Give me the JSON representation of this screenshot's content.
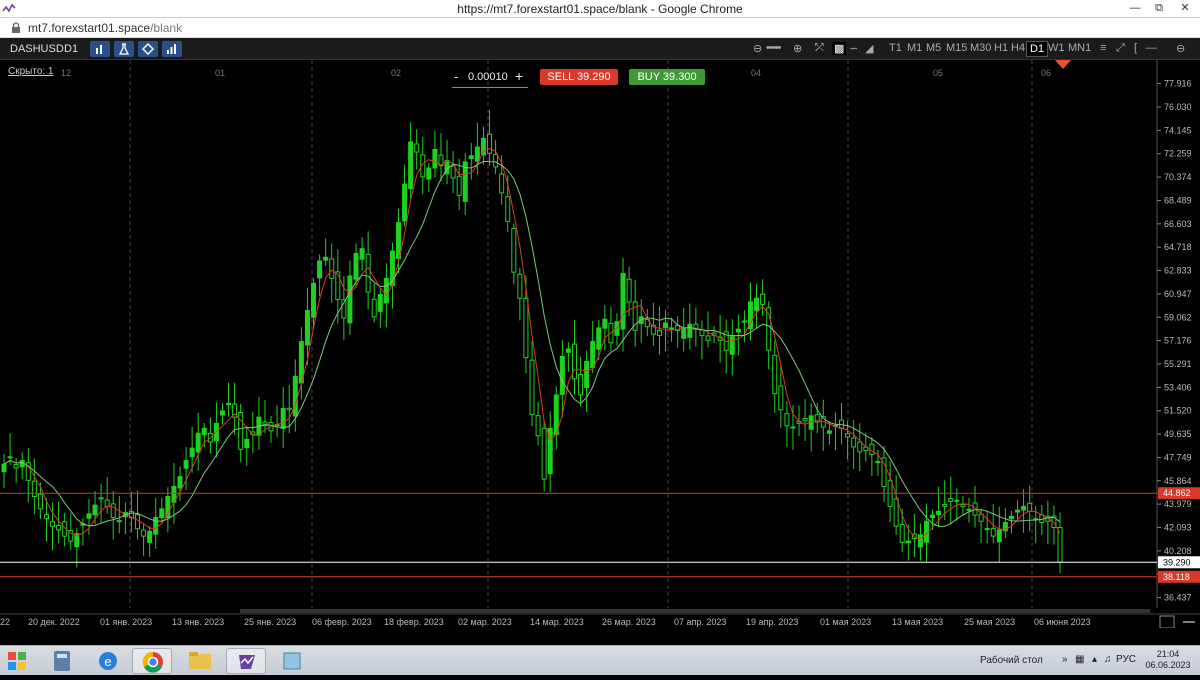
{
  "browser": {
    "window_title": "https://mt7.forexstart01.space/blank - Google Chrome",
    "url_host": "mt7.forexstart01.space",
    "url_path": "/blank"
  },
  "toolbar": {
    "symbol": "DASHUSD",
    "timeframe": "D1",
    "timeframes": [
      "T1",
      "M1",
      "M5",
      "M15",
      "M30",
      "H1",
      "H4",
      "D1",
      "W1",
      "MN1"
    ],
    "active_timeframe": "D1"
  },
  "chart": {
    "hidden_link": "Скрыто: 1",
    "lot": "0.00010",
    "lot_minus": "-",
    "lot_plus": "+",
    "sell_label": "SELL 39.290",
    "buy_label": "BUY 39.300"
  },
  "taskbar": {
    "desktop_label": "Рабочий стол",
    "language": "РУС",
    "time": "21:04",
    "date": "06.06.2023"
  },
  "chart_data": {
    "type": "candlestick",
    "symbol": "DASHUSD",
    "timeframe": "D1",
    "y_ticks": [
      77.916,
      76.03,
      74.145,
      72.259,
      70.374,
      68.489,
      66.603,
      64.718,
      62.833,
      60.947,
      59.062,
      57.176,
      55.291,
      53.406,
      51.52,
      49.635,
      47.749,
      45.864,
      43.979,
      42.093,
      40.208,
      38.323,
      36.437
    ],
    "ylim": [
      35.6,
      79.5
    ],
    "x_tick_labels": [
      "22",
      "20 дек. 2022",
      "01 янв. 2023",
      "13 янв. 2023",
      "25 янв. 2023",
      "06 февр. 2023",
      "18 февр. 2023",
      "02 мар. 2023",
      "14 мар. 2023",
      "26 мар. 2023",
      "07 апр. 2023",
      "19 апр. 2023",
      "01 мая 2023",
      "13 мая 2023",
      "25 мая 2023",
      "06 июня 2023"
    ],
    "top_labels": [
      "12",
      "01",
      "02",
      "03",
      "04",
      "05",
      "06"
    ],
    "horizontal_lines": [
      {
        "value": 44.862,
        "color": "#d8392b",
        "label": "44.862"
      },
      {
        "value": 39.29,
        "color": "#ffffff",
        "label": "39.290"
      },
      {
        "value": 38.118,
        "color": "#d8392b",
        "label": "38.118"
      }
    ],
    "closes": [
      47.2,
      47.8,
      46.9,
      47.5,
      45.9,
      44.6,
      43.6,
      42.8,
      42.2,
      41.9,
      41.4,
      41.0,
      41.6,
      42.4,
      43.2,
      43.9,
      44.4,
      43.8,
      42.9,
      42.6,
      43.3,
      42.9,
      42.0,
      41.4,
      41.8,
      42.9,
      43.6,
      44.6,
      45.4,
      46.2,
      47.5,
      48.5,
      49.7,
      50.1,
      49.0,
      50.5,
      51.5,
      52.1,
      51.0,
      48.4,
      49.2,
      49.6,
      51.0,
      50.3,
      49.9,
      50.4,
      51.7,
      51.6,
      54.3,
      57.1,
      59.6,
      61.8,
      63.6,
      63.9,
      62.2,
      60.5,
      59.0,
      62.4,
      64.2,
      64.6,
      61.1,
      59.1,
      60.9,
      62.2,
      64.4,
      66.7,
      69.8,
      73.2,
      72.4,
      70.4,
      71.1,
      72.6,
      71.3,
      71.7,
      70.3,
      68.9,
      71.6,
      72.1,
      72.8,
      73.5,
      72.3,
      71.2,
      69.1,
      66.8,
      62.7,
      60.6,
      55.8,
      51.2,
      49.5,
      46.0,
      50.1,
      52.8,
      55.9,
      56.5,
      54.1,
      52.8,
      55.5,
      57.1,
      58.2,
      58.9,
      57.0,
      58.7,
      62.6,
      60.3,
      58.0,
      59.1,
      58.3,
      57.7,
      57.6,
      58.6,
      58.2,
      58.0,
      58.1,
      58.5,
      58.1,
      57.6,
      57.2,
      57.6,
      57.2,
      56.4,
      57.5,
      58.1,
      58.7,
      60.3,
      60.6,
      60.1,
      56.4,
      52.9,
      51.6,
      50.3,
      50.2,
      50.5,
      50.7,
      51.1,
      50.6,
      50.2,
      49.9,
      50.3,
      50.1,
      49.4,
      48.6,
      48.2,
      48.3,
      48.0,
      47.4,
      45.4,
      43.8,
      42.2,
      40.9,
      41.0,
      41.2,
      41.5,
      42.6,
      43.1,
      43.4,
      43.8,
      44.2,
      44.3,
      43.8,
      43.5,
      43.1,
      42.6,
      42.0,
      41.4,
      41.9,
      42.5,
      43.0,
      43.5,
      43.8,
      43.4,
      42.8,
      42.5,
      42.6,
      42.1,
      39.3
    ]
  }
}
